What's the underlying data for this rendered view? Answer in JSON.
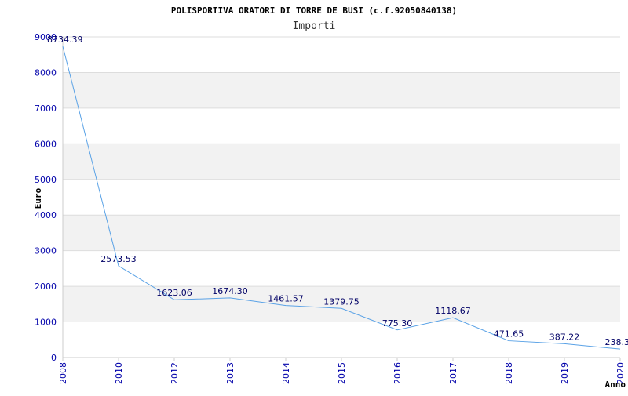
{
  "chart_data": {
    "type": "line",
    "title": "POLISPORTIVA ORATORI DI TORRE DE BUSI (c.f.92050840138)",
    "subtitle": "Importi",
    "xlabel": "Anno",
    "ylabel": "Euro",
    "categories": [
      "2008",
      "2010",
      "2012",
      "2013",
      "2014",
      "2015",
      "2016",
      "2017",
      "2018",
      "2019",
      "2020"
    ],
    "values": [
      8734.39,
      2573.53,
      1623.06,
      1674.3,
      1461.57,
      1379.75,
      775.3,
      1118.67,
      471.65,
      387.22,
      238.3
    ],
    "value_labels": [
      "8734.39",
      "2573.53",
      "1623.06",
      "1674.30",
      "1461.57",
      "1379.75",
      "775.30",
      "1118.67",
      "471.65",
      "387.22",
      "238.3"
    ],
    "ylim": [
      0,
      9000
    ],
    "yticks": [
      "0",
      "1000",
      "2000",
      "3000",
      "4000",
      "5000",
      "6000",
      "7000",
      "8000",
      "9000"
    ],
    "grid": true,
    "legend": "none",
    "colors": {
      "line": "#5aa2e6",
      "band": "#f2f2f2",
      "grid": "#dddddd",
      "tick_text": "#0000aa",
      "label_text": "#000066"
    }
  }
}
